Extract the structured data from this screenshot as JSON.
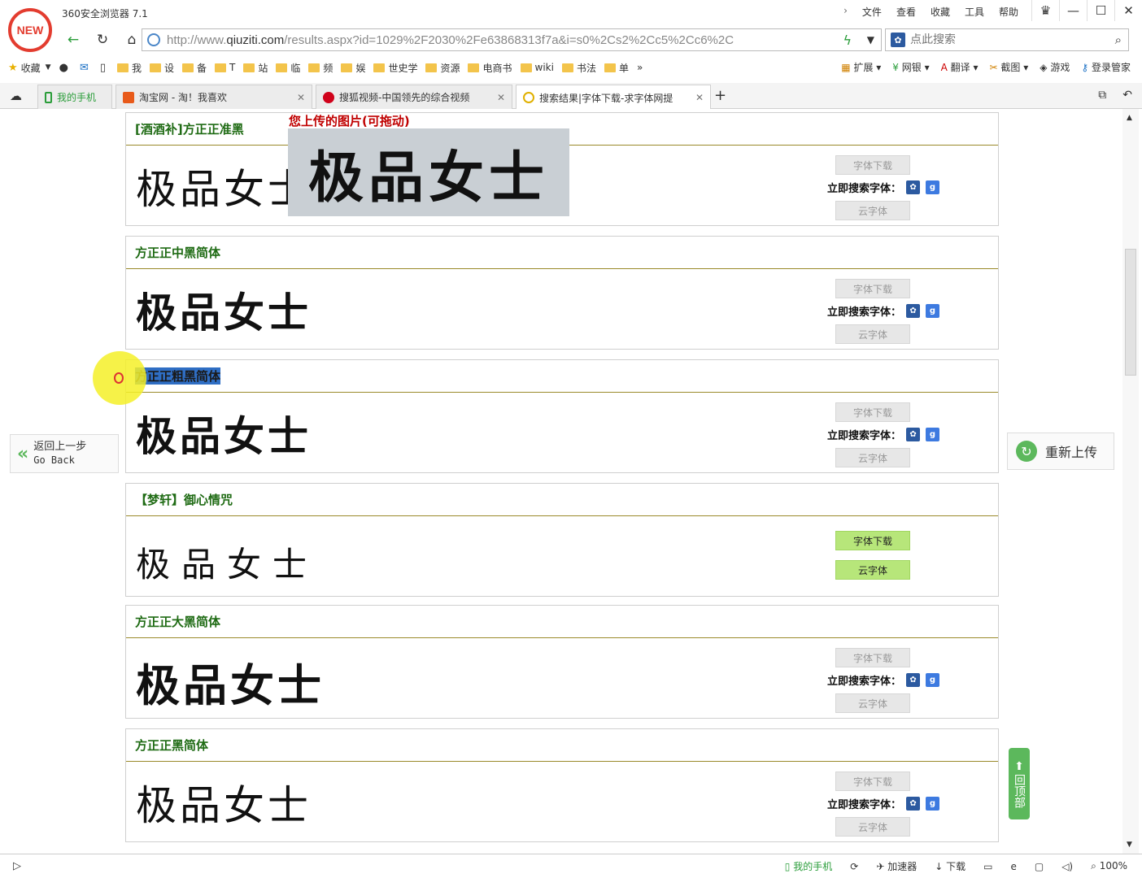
{
  "app": {
    "title": "360安全浏览器 7.1",
    "logo_text": "NEW",
    "menu": [
      "文件",
      "查看",
      "收藏",
      "工具",
      "帮助"
    ],
    "window_buttons": [
      "♛",
      "—",
      "☐",
      "✕"
    ]
  },
  "address": {
    "url_prefix": "http://www.",
    "url_domain": "qiuziti.com",
    "url_rest": "/results.aspx?id=1029%2F2030%2Fe63868313f7a&i=s0%2Cs2%2Cc5%2Cc6%2C",
    "search_placeholder": "点此搜索"
  },
  "bookmarks": {
    "favorites_label": "收藏",
    "folders": [
      "我",
      "设",
      "备",
      "T",
      "站",
      "临",
      "频",
      "娱",
      "世史学",
      "资源",
      "电商书",
      "wiki",
      "书法",
      "单"
    ],
    "more": "»",
    "extensions": [
      "扩展",
      "网银",
      "翻译",
      "截图",
      "游戏",
      "登录管家"
    ]
  },
  "tabs": [
    {
      "label": "我的手机",
      "color": "#2a9d3a"
    },
    {
      "label": "淘宝网 - 淘！我喜欢",
      "color": "#e85a1a"
    },
    {
      "label": "搜狐视频-中国领先的综合视频",
      "color": "#d0021b"
    },
    {
      "label": "搜索结果|字体下载-求字体网提",
      "color": "#f0c020"
    }
  ],
  "content": {
    "upload_label": "您上传的图片(可拖动)",
    "upload_text": "极品女士",
    "download_label": "字体下载",
    "search_label": "立即搜索字体：",
    "cloud_label": "云字体",
    "go_back_cn": "返回上一步",
    "go_back_en": "Go Back",
    "reupload_label": "重新上传",
    "to_top_label": "回顶部",
    "results": [
      {
        "name": "[酒酒补]方正正准黑",
        "preview": "极品女士",
        "buttons": "grey"
      },
      {
        "name": "方正正中黑简体",
        "preview": "极品女士",
        "buttons": "grey"
      },
      {
        "name": "方正正粗黑简体",
        "preview": "极品女士",
        "buttons": "grey",
        "selected": true
      },
      {
        "name": "【梦轩】御心情咒",
        "preview": "极品女士",
        "buttons": "green"
      },
      {
        "name": "方正正大黑简体",
        "preview": "极品女士",
        "buttons": "grey"
      },
      {
        "name": "方正正黑简体",
        "preview": "极品女士",
        "buttons": "grey"
      }
    ]
  },
  "status": {
    "items": [
      "我的手机",
      "加速器",
      "下载"
    ],
    "zoom": "100%"
  }
}
